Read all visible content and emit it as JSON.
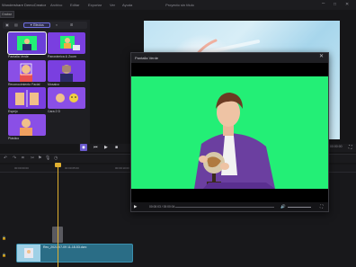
{
  "titlebar": {
    "app": "Wondershare DemoCreator",
    "menus": [
      "Archivo",
      "Editar",
      "Exportar",
      "Ver",
      "Ayuda"
    ],
    "project": "Proyecto sin título",
    "controls": [
      "–",
      "□",
      "✕"
    ]
  },
  "left_panel": {
    "subtab": "Grabar",
    "active_tab": "Efectos",
    "tiles": [
      {
        "label": "Pantalla Verde"
      },
      {
        "label": "Panorámica & Zoom"
      },
      {
        "label": "Reconocimiento Facial"
      },
      {
        "label": "Mosaico"
      },
      {
        "label": "Espejo"
      },
      {
        "label": "Cara 2 D"
      },
      {
        "label": "Plástico"
      }
    ]
  },
  "preview": {
    "time": "00:00:00"
  },
  "timeline": {
    "ruler": [
      "00:00:00:00",
      "00:00:05:00",
      "00:00:10:00",
      "00:00:15:00",
      "00:00:20:00"
    ],
    "clip_name": "Rec_2021-07-09 11-18-53.dcrc"
  },
  "popup": {
    "title": "Pantalla Verde",
    "close": "✕",
    "time": "00:00:03 / 00:00:04"
  },
  "colors": {
    "accent": "#6a5acd",
    "green_screen": "#23ef76",
    "clip": "#2a6d86",
    "playhead": "#e0b030"
  }
}
